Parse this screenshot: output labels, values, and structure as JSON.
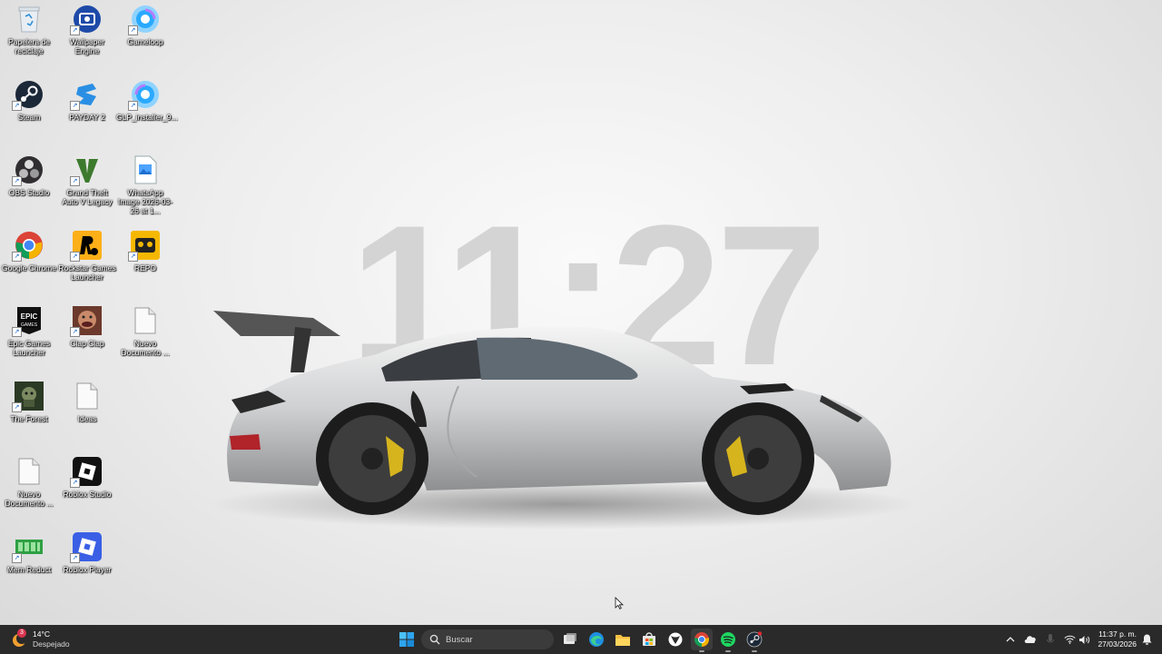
{
  "wallpaper": {
    "clock_text": "11:27"
  },
  "desktop_icons": [
    {
      "label": "Papelera de reciclaje",
      "icon": "recycle-bin-icon"
    },
    {
      "label": "Wallpaper Engine",
      "icon": "wallpaper-engine-icon"
    },
    {
      "label": "Gameloop",
      "icon": "gameloop-icon"
    },
    {
      "label": "Steam",
      "icon": "steam-icon"
    },
    {
      "label": "PAYDAY 2",
      "icon": "payday2-icon"
    },
    {
      "label": "GLP_installer_9...",
      "icon": "gameloop-installer-icon"
    },
    {
      "label": "OBS Studio",
      "icon": "obs-icon"
    },
    {
      "label": "Grand Theft Auto V Legacy",
      "icon": "gta5-icon"
    },
    {
      "label": "WhatsApp Image 2026-03-26 at 1...",
      "icon": "image-file-icon"
    },
    {
      "label": "Google Chrome",
      "icon": "chrome-icon"
    },
    {
      "label": "Rockstar Games Launcher",
      "icon": "rockstar-icon"
    },
    {
      "label": "REPO",
      "icon": "repo-icon"
    },
    {
      "label": "Epic Games Launcher",
      "icon": "epic-games-icon"
    },
    {
      "label": "Clap Clap",
      "icon": "clap-clap-icon"
    },
    {
      "label": "Nuevo Documento ...",
      "icon": "text-document-icon"
    },
    {
      "label": "The Forest",
      "icon": "the-forest-icon"
    },
    {
      "label": "Ideas",
      "icon": "text-document-icon"
    },
    {
      "label": "Nuevo Documento ...",
      "icon": "text-document-icon"
    },
    {
      "label": "Roblox Studio",
      "icon": "roblox-studio-icon"
    },
    {
      "label": "Mem Reduct",
      "icon": "mem-reduct-icon"
    },
    {
      "label": "Roblox Player",
      "icon": "roblox-player-icon"
    }
  ],
  "taskbar": {
    "weather": {
      "badge": "3",
      "temp": "14°C",
      "condition": "Despejado"
    },
    "search_placeholder": "Buscar",
    "apps": [
      "start-icon",
      "task-view-icon",
      "edge-icon",
      "file-explorer-icon",
      "store-icon",
      "xbox-icon",
      "chrome-icon",
      "spotify-icon",
      "steam-icon"
    ],
    "tray": [
      "show-hidden-icons-chevron",
      "onedrive-icon",
      "microphone-icon",
      "wifi-icon",
      "volume-icon"
    ],
    "clock": {
      "time": "11:37 p. m.",
      "date": "27/03/2026"
    }
  },
  "colors": {
    "taskbar": "#2a2a2a",
    "accent": "#0a84ff"
  }
}
